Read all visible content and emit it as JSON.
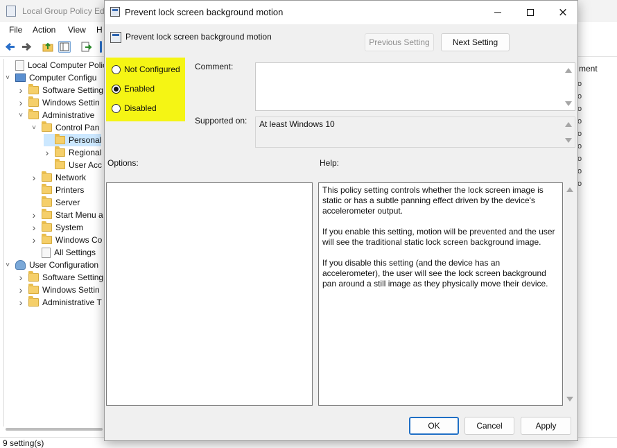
{
  "bg": {
    "title": "Local Group Policy Edi",
    "menu": [
      "File",
      "Action",
      "View",
      "H"
    ],
    "tree": [
      {
        "label": "Local Computer Policy",
        "level": 0,
        "icon": "doc",
        "chev": ""
      },
      {
        "label": "Computer Configu",
        "level": 0,
        "icon": "pc",
        "chev": "down"
      },
      {
        "label": "Software Setting",
        "level": 1,
        "icon": "folder",
        "chev": "right"
      },
      {
        "label": "Windows Settin",
        "level": 1,
        "icon": "folder",
        "chev": "right"
      },
      {
        "label": "Administrative",
        "level": 1,
        "icon": "folder",
        "chev": "down"
      },
      {
        "label": "Control Pan",
        "level": 2,
        "icon": "folder",
        "chev": "down"
      },
      {
        "label": "Personal",
        "level": 3,
        "icon": "folder",
        "chev": "",
        "selected": true
      },
      {
        "label": "Regional",
        "level": 3,
        "icon": "folder",
        "chev": "right"
      },
      {
        "label": "User Acc",
        "level": 3,
        "icon": "folder",
        "chev": ""
      },
      {
        "label": "Network",
        "level": 2,
        "icon": "folder",
        "chev": "right"
      },
      {
        "label": "Printers",
        "level": 2,
        "icon": "folder",
        "chev": ""
      },
      {
        "label": "Server",
        "level": 2,
        "icon": "folder",
        "chev": ""
      },
      {
        "label": "Start Menu a",
        "level": 2,
        "icon": "folder",
        "chev": "right"
      },
      {
        "label": "System",
        "level": 2,
        "icon": "folder",
        "chev": "right"
      },
      {
        "label": "Windows Co",
        "level": 2,
        "icon": "folder",
        "chev": "right"
      },
      {
        "label": "All Settings",
        "level": 2,
        "icon": "doc",
        "chev": ""
      },
      {
        "label": "User Configuration",
        "level": 0,
        "icon": "user",
        "chev": "down"
      },
      {
        "label": "Software Setting",
        "level": 1,
        "icon": "folder",
        "chev": "right"
      },
      {
        "label": "Windows Settin",
        "level": 1,
        "icon": "folder",
        "chev": "right"
      },
      {
        "label": "Administrative T",
        "level": 1,
        "icon": "folder",
        "chev": "right"
      }
    ],
    "right_header": "ment",
    "right_marks": [
      "o",
      "o",
      "o",
      "o",
      "o",
      "o",
      "o",
      "o",
      "o"
    ],
    "status": "9 setting(s)"
  },
  "dialog": {
    "title": "Prevent lock screen background motion",
    "window_controls": {
      "minimize": "minimize-icon",
      "maximize": "maximize-icon",
      "close": "×"
    },
    "policy_name": "Prevent lock screen background motion",
    "prev_button": "Previous Setting",
    "next_button": "Next Setting",
    "radios": [
      {
        "label": "Not Configured",
        "checked": false
      },
      {
        "label": "Enabled",
        "checked": true
      },
      {
        "label": "Disabled",
        "checked": false
      }
    ],
    "comment_label": "Comment:",
    "comment_value": "",
    "supported_label": "Supported on:",
    "supported_value": "At least Windows 10",
    "options_label": "Options:",
    "help_label": "Help:",
    "help_paragraphs": [
      "This policy setting controls whether the lock screen image is static or has a subtle panning effect driven by the device's accelerometer output.",
      "If you enable this setting, motion will be prevented and the user will see the traditional static lock screen background image.",
      "If you disable this setting (and the device has an accelerometer), the user will see the lock screen background pan around a still image as they physically move their device."
    ],
    "ok_button": "OK",
    "cancel_button": "Cancel",
    "apply_button": "Apply"
  },
  "colors": {
    "highlight": "#f5f514",
    "selection": "#cce8ff",
    "default_button_border": "#1f6fc5"
  }
}
